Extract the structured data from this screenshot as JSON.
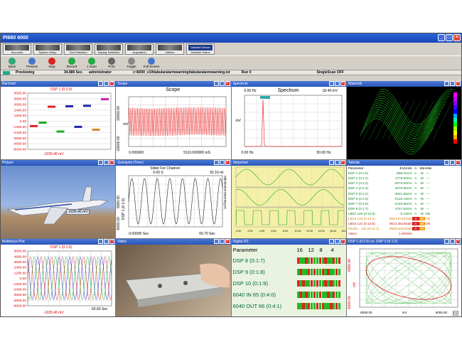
{
  "app": {
    "title": "PI660 6000"
  },
  "modules": [
    {
      "label": "Accounts"
    },
    {
      "label": "System Setup"
    },
    {
      "label": "Test Definition"
    },
    {
      "label": "Display Definition"
    },
    {
      "label": "Acquisition"
    },
    {
      "label": "Utilities"
    },
    {
      "label": "DataNet Status",
      "brand": "DataNet Server"
    }
  ],
  "toolbar": [
    {
      "label": "Back",
      "icon": "back-icon",
      "color": "#3a7"
    },
    {
      "label": "Preview",
      "icon": "preview-icon",
      "color": "#47c"
    },
    {
      "label": "Stop",
      "icon": "stop-icon",
      "color": "#d22"
    },
    {
      "label": "Record",
      "icon": "record-icon",
      "color": "#2a4"
    },
    {
      "label": "1 Scan",
      "icon": "scan-icon",
      "color": "#2a4"
    },
    {
      "label": "Print",
      "icon": "print-icon",
      "color": "#666"
    },
    {
      "label": "Toggle",
      "icon": "toggle-icon",
      "color": "#888"
    },
    {
      "label": "Full Screen",
      "icon": "fullscreen-icon",
      "color": "#47c"
    }
  ],
  "status": {
    "mode": "Previewing",
    "time": "34.880 Sec.",
    "user": "administrator",
    "file": "c:\\6000_v10\\tabularalarmwarning\\tabularalarmwarning.txt",
    "run": "Run 0",
    "singlescan": "SingleScan OFF"
  },
  "panes": {
    "barchart": {
      "title": "Barchart",
      "label": "DSP 1 (0:1:0)",
      "ticks": [
        "6000.00",
        "4800.00",
        "3600.00",
        "2400.00",
        "1200.00",
        "0.00",
        "-1200.00",
        "-2400.00",
        "-3600.00",
        "-4800.00",
        "-6000.00"
      ],
      "reading": "-1035.46   mV"
    },
    "scope": {
      "title": "Scope",
      "heading": "Scope",
      "ymax": "10000.00",
      "ymin": "-10000.00",
      "ylabel": "mV",
      "xmin": "0.000000",
      "xmax": "5110.000000 mS"
    },
    "spectrum": {
      "title": "Spectrum",
      "heading": "Spectrum",
      "freq_left": "0.00 Hz",
      "amp_right": "18.49 mV",
      "xmin": "0.00 Hz",
      "xmax": "50.00 Hz",
      "ylabel": "mV"
    },
    "waterfall": {
      "title": "Waterfall"
    },
    "picture": {
      "title": "Picture",
      "reading": "-1035.46 mV"
    },
    "quickplot": {
      "title": "Quickplot (Time)",
      "heading": "Slider For Channel",
      "left": "0.00 S",
      "right": "92.16 ml",
      "ymax": "5000.00",
      "ymin": "-5000.00",
      "ylabel": "DSP 1 (0:1:0)",
      "xmin": "0.00000 Sec",
      "xmax": "60.70 Sec",
      "side": "tabularalarmwarning.txt"
    },
    "stripchart": {
      "title": "Stripchart",
      "ticks": [
        "0.00",
        "2.00",
        "4.00",
        "6.00",
        "8.00",
        "10.00",
        "12.00",
        "14.00",
        "16.00",
        "18.00"
      ]
    },
    "tabular": {
      "title": "Tabular",
      "headers": [
        "Parameter",
        "EUUnits",
        "A",
        "Wa",
        "Hdw"
      ],
      "rows": [
        {
          "name": "DSP 1 (0:1:0)",
          "value": "-885.01mV",
          "a": "A",
          "w": "W",
          "h": "---",
          "color": "#0a8a20"
        },
        {
          "name": "DSP 2 (0:1:1)",
          "value": "1770.94mV",
          "a": "A",
          "w": "W",
          "h": "---",
          "color": "#0a8a20"
        },
        {
          "name": "DSP 3 (0:1:2)",
          "value": "-2570.50mV",
          "a": "A",
          "w": "W",
          "h": "---",
          "color": "#0a8a20"
        },
        {
          "name": "DSP 4 (0:1:3)",
          "value": "2570.50mV",
          "a": "A",
          "w": "W",
          "h": "---",
          "color": "#0a8a20"
        },
        {
          "name": "DSP 5 (0:1:4)",
          "value": "-3941.65mV",
          "a": "A",
          "w": "W",
          "h": "---",
          "color": "#0a8a20"
        },
        {
          "name": "DSP 6 (0:1:5)",
          "value": "-2148.19mV",
          "a": "A",
          "w": "W",
          "h": "---",
          "color": "#0a8a20"
        },
        {
          "name": "DSP 7 (0:1:6)",
          "value": "-2410.89mV",
          "a": "A",
          "w": "W",
          "h": "---",
          "color": "#0a8a20"
        },
        {
          "name": "DSP 8 (0:1:7)",
          "value": "4747.62mV",
          "a": "A",
          "w": "W",
          "h": "---",
          "color": "#0a8a20"
        },
        {
          "name": "LBS1 129 (0:12:0)",
          "value": "-0.19mV",
          "a": "A",
          "w": "W",
          "h": "ON",
          "color": "#0a8a20"
        },
        {
          "name": "LBS2 130 (0:12:1)",
          "value": "-6943.97uStrain",
          "a": "A",
          "w": "W",
          "h": "ON",
          "color": "#d08010",
          "alarm": true
        },
        {
          "name": "LBS3 131 (0:13:0)",
          "value": "9014.45uStrain",
          "a": "A",
          "w": "W",
          "h": "ON",
          "color": "#c01818",
          "alarm": true
        },
        {
          "name": "Pacific - 132 (0:13:1)",
          "value": "9999.60uStrain",
          "a": "A",
          "w": "W",
          "h": "---",
          "color": "#d08010",
          "alarm": true
        },
        {
          "name": "Alarm",
          "value": "1.000ON",
          "a": "",
          "w": "",
          "h": "",
          "color": "#c01818"
        }
      ]
    },
    "multitrace": {
      "title": "Multitrace Plot",
      "label": "DSP 1 (0:1:0)",
      "ticks": [
        "6000.00",
        "4800.00",
        "3600.00",
        "2400.00",
        "1200.00",
        "0.00",
        "-1200.00",
        "-2400.00",
        "-3600.00",
        "-4800.00",
        "-6000.00"
      ],
      "reading": "-1035.46   mV",
      "xright": "60.69 Sec"
    },
    "video": {
      "title": "Video"
    },
    "digitalio": {
      "title": "Digital I/O",
      "param_header": "Parameter",
      "bits": [
        "16",
        "12",
        "8",
        "4"
      ],
      "rows": [
        {
          "name": "DSP 8 (0:1:7)"
        },
        {
          "name": "DSP 9 (0:1:8)"
        },
        {
          "name": "DSP 10 (0:1:9)"
        },
        {
          "name": "6040 IN 65 (0:4:0)"
        },
        {
          "name": "6040 OUT 66 (0:4:1)"
        }
      ]
    },
    "xyplot": {
      "title": "DSP 1 (0:1:0) vs. DSP 3 (0:1:2)",
      "ymax": "6000.00",
      "ymin": "-6000.00",
      "ylabel": "mV",
      "xmin": "-6000.00",
      "xmid": "mV",
      "xmax": "6000.00",
      "ctrl": "Ctr"
    }
  },
  "chart_data": [
    {
      "type": "bar",
      "title": "DSP 1 (0:1:0)",
      "ylim": [
        -6000,
        6000
      ],
      "values": [
        -1035.46,
        -300,
        3100,
        -2200,
        3200,
        -1200,
        3300,
        -1800,
        4700
      ]
    },
    {
      "type": "line",
      "title": "Scope",
      "ylim": [
        -10000,
        10000
      ],
      "xlim": [
        0,
        5110
      ]
    }
  ]
}
